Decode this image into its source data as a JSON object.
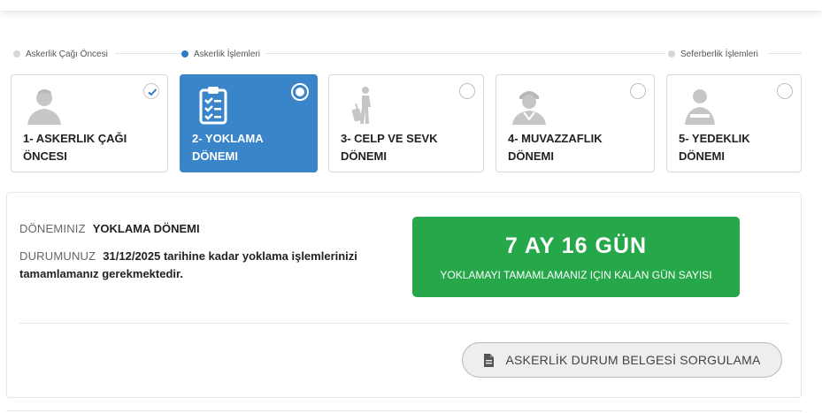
{
  "phases": [
    {
      "label": "Askerlik Çağı Öncesi",
      "active": false
    },
    {
      "label": "Askerlik İşlemleri",
      "active": true
    },
    {
      "label": "Seferberlik İşlemleri",
      "active": false
    }
  ],
  "steps": [
    {
      "label": "1- ASKERLIK ÇAĞI\nÖNCESI",
      "icon": "person-silhouette-icon",
      "state": "completed"
    },
    {
      "label": "2- YOKLAMA\nDÖNEMI",
      "icon": "clipboard-checklist-icon",
      "state": "current"
    },
    {
      "label": "3- CELP VE SEVK\nDÖNEMI",
      "icon": "traveler-luggage-icon",
      "state": "pending"
    },
    {
      "label": "4- MUVAZZAFLIK\nDÖNEMI",
      "icon": "soldier-icon",
      "state": "pending"
    },
    {
      "label": "5- YEDEKLIK\nDÖNEMI",
      "icon": "reserve-person-icon",
      "state": "pending"
    }
  ],
  "info": {
    "period_key": "DÖNEMINIZ",
    "period_value": "YOKLAMA DÖNEMI",
    "status_key": "DURUMUNUZ",
    "status_value_line1": "31/12/2025 tarihine kadar yoklama işlemlerinizi",
    "status_value_line2": "tamamlamanız gerekmektedir."
  },
  "countdown": {
    "value": "7 AY 16 GÜN",
    "caption": "YOKLAMAYI TAMAMLAMANIZ IÇIN KALAN GÜN SAYISI",
    "color": "#25a74a"
  },
  "query_button": {
    "label": "ASKERLİK DURUM BELGESİ SORGULAMA",
    "icon": "document-icon"
  },
  "colors": {
    "accent": "#3a84c9",
    "success": "#25a74a"
  }
}
